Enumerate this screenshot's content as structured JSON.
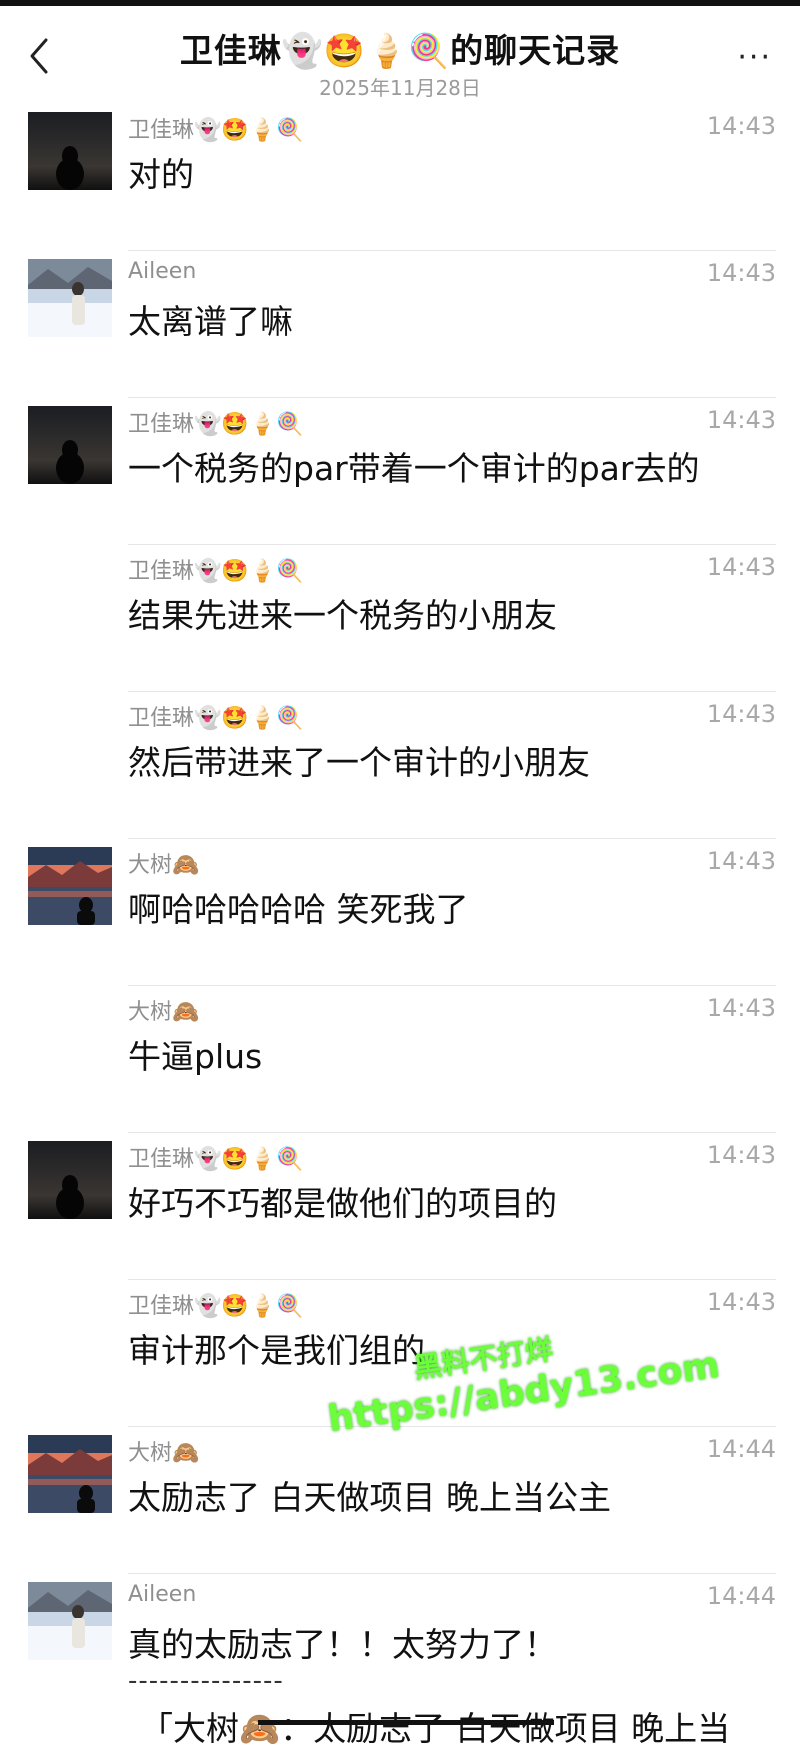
{
  "header": {
    "title": "卫佳琳👻🤩🍦🍭的聊天记录",
    "date": "2025年11月28日",
    "more": "···"
  },
  "messages": [
    {
      "sender": "卫佳琳👻🤩🍦🍭",
      "time": "14:43",
      "text": "对的",
      "avatar": "dark-silhouette-avatar"
    },
    {
      "sender": "Aileen",
      "time": "14:43",
      "text": "太离谱了嘛",
      "avatar": "snow-girl-avatar"
    },
    {
      "sender": "卫佳琳👻🤩🍦🍭",
      "time": "14:43",
      "text": "一个税务的par带着一个审计的par去的",
      "avatar": "dark-silhouette-avatar"
    },
    {
      "sender": "卫佳琳👻🤩🍦🍭",
      "time": "14:43",
      "text": "结果先进来一个税务的小朋友",
      "avatar": ""
    },
    {
      "sender": "卫佳琳👻🤩🍦🍭",
      "time": "14:43",
      "text": "然后带进来了一个审计的小朋友",
      "avatar": ""
    },
    {
      "sender": "大树🙈",
      "time": "14:43",
      "text": "啊哈哈哈哈哈 笑死我了",
      "avatar": "sunset-mountain-avatar"
    },
    {
      "sender": "大树🙈",
      "time": "14:43",
      "text": "牛逼plus",
      "avatar": ""
    },
    {
      "sender": "卫佳琳👻🤩🍦🍭",
      "time": "14:43",
      "text": "好巧不巧都是做他们的项目的",
      "avatar": "dark-silhouette-avatar"
    },
    {
      "sender": "卫佳琳👻🤩🍦🍭",
      "time": "14:43",
      "text": "审计那个是我们组的",
      "avatar": ""
    },
    {
      "sender": "大树🙈",
      "time": "14:44",
      "text": "太励志了 白天做项目 晚上当公主",
      "avatar": "sunset-mountain-avatar"
    },
    {
      "sender": "Aileen",
      "time": "14:44",
      "text": "真的太励志了！！太努力了！",
      "avatar": "snow-girl-avatar"
    }
  ],
  "quote": {
    "dashes": "---------------",
    "text": "「大树🙈：太励志了 白天做项目 晚上当"
  },
  "watermark": {
    "line1": "黑料不打烊",
    "line2": "https://abdy13.com"
  }
}
